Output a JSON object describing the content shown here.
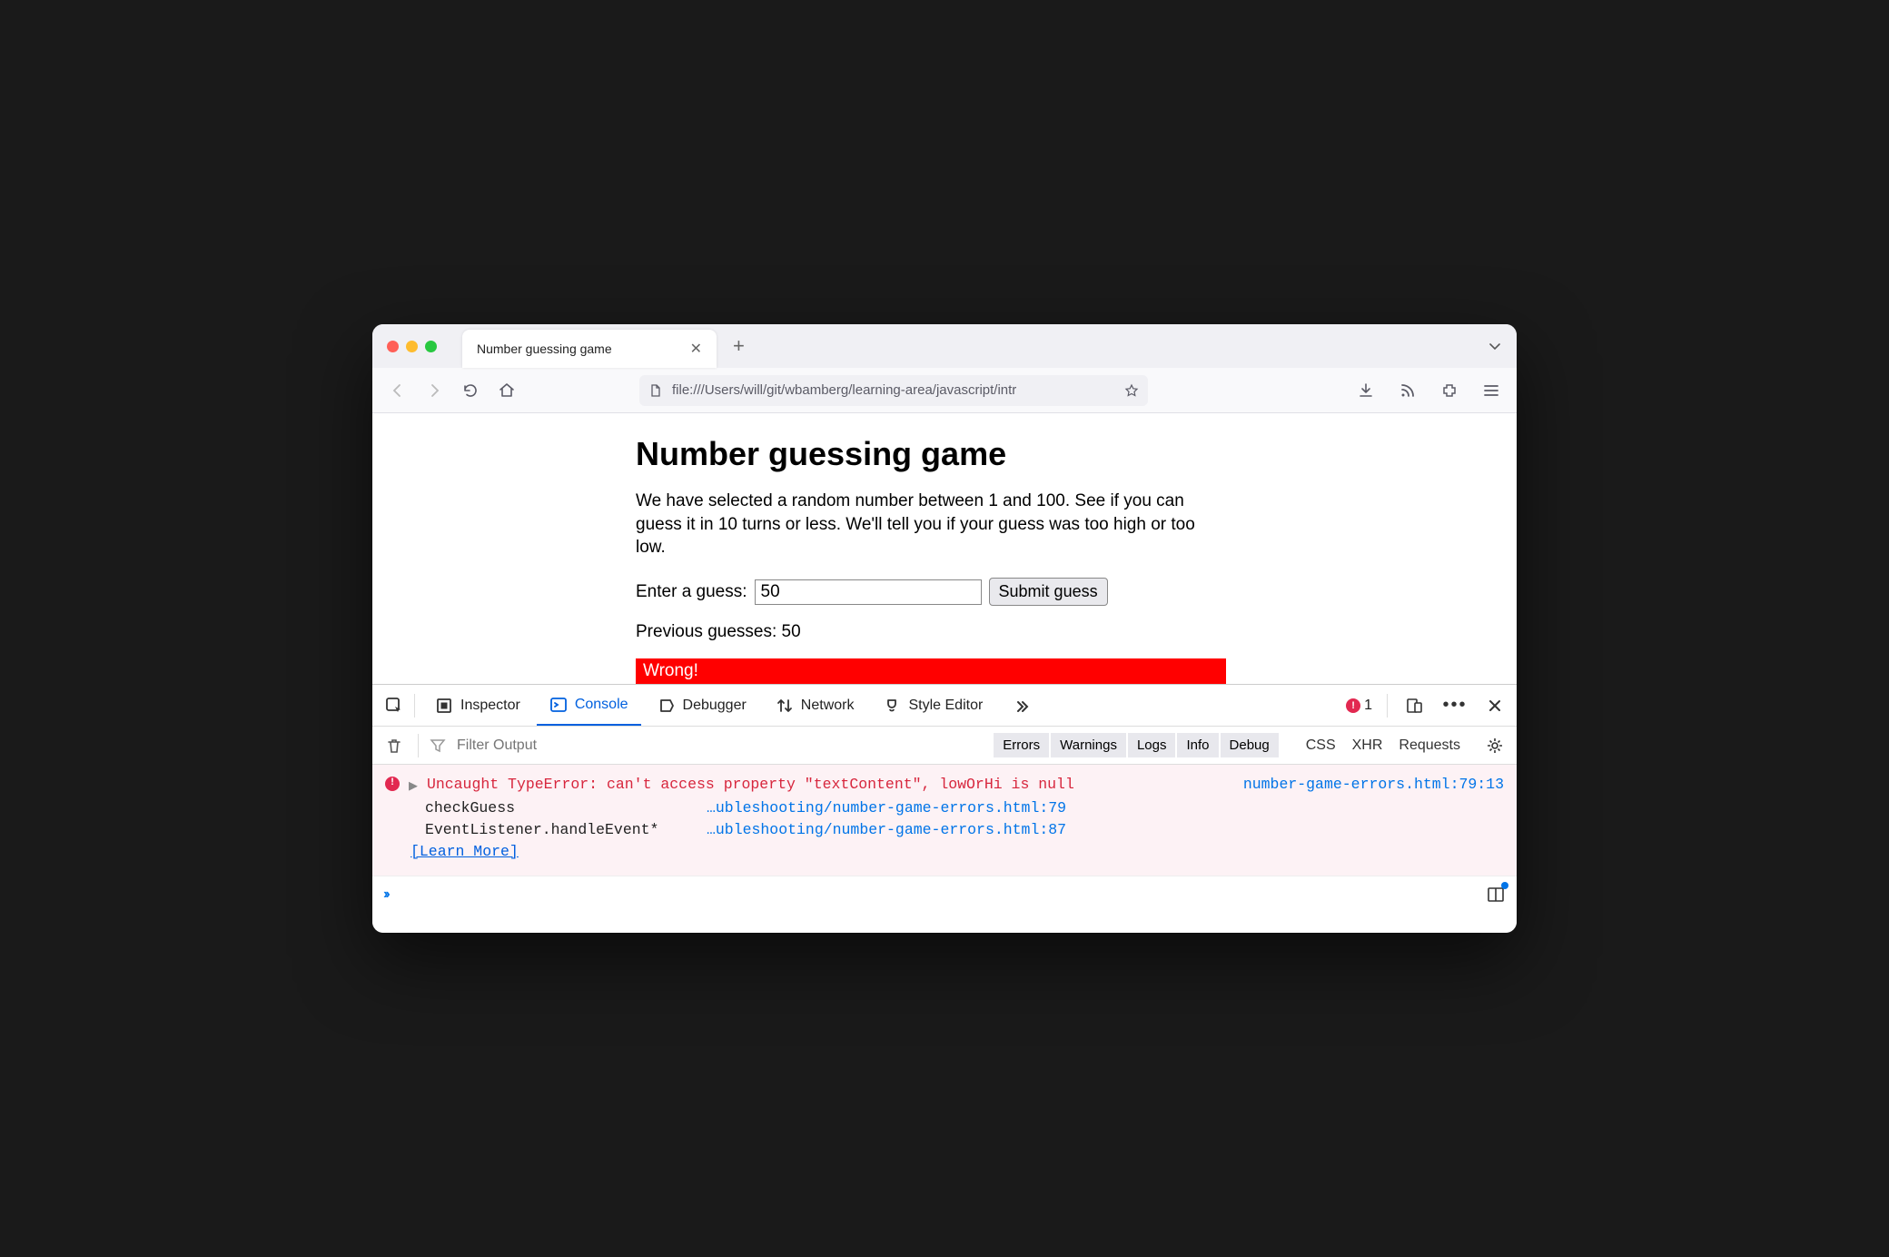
{
  "tab": {
    "title": "Number guessing game"
  },
  "url": "file:///Users/will/git/wbamberg/learning-area/javascript/intr",
  "page": {
    "heading": "Number guessing game",
    "description": "We have selected a random number between 1 and 100. See if you can guess it in 10 turns or less. We'll tell you if your guess was too high or too low.",
    "guess_label": "Enter a guess:",
    "guess_value": "50",
    "submit_label": "Submit guess",
    "previous_label": "Previous guesses: 50",
    "result_text": "Wrong!"
  },
  "devtools": {
    "tabs": {
      "inspector": "Inspector",
      "console": "Console",
      "debugger": "Debugger",
      "network": "Network",
      "style_editor": "Style Editor"
    },
    "error_count": "1",
    "filter_placeholder": "Filter Output",
    "pills": {
      "errors": "Errors",
      "warnings": "Warnings",
      "logs": "Logs",
      "info": "Info",
      "debug": "Debug"
    },
    "links": {
      "css": "CSS",
      "xhr": "XHR",
      "requests": "Requests"
    }
  },
  "console": {
    "error_message": "Uncaught TypeError: can't access property \"textContent\", lowOrHi is null",
    "source": "number-game-errors.html:79:13",
    "stack": [
      {
        "fn": "checkGuess",
        "loc": "…ubleshooting/number-game-errors.html:79"
      },
      {
        "fn": "EventListener.handleEvent*",
        "loc": "…ubleshooting/number-game-errors.html:87"
      }
    ],
    "learn_more": "[Learn More]"
  }
}
